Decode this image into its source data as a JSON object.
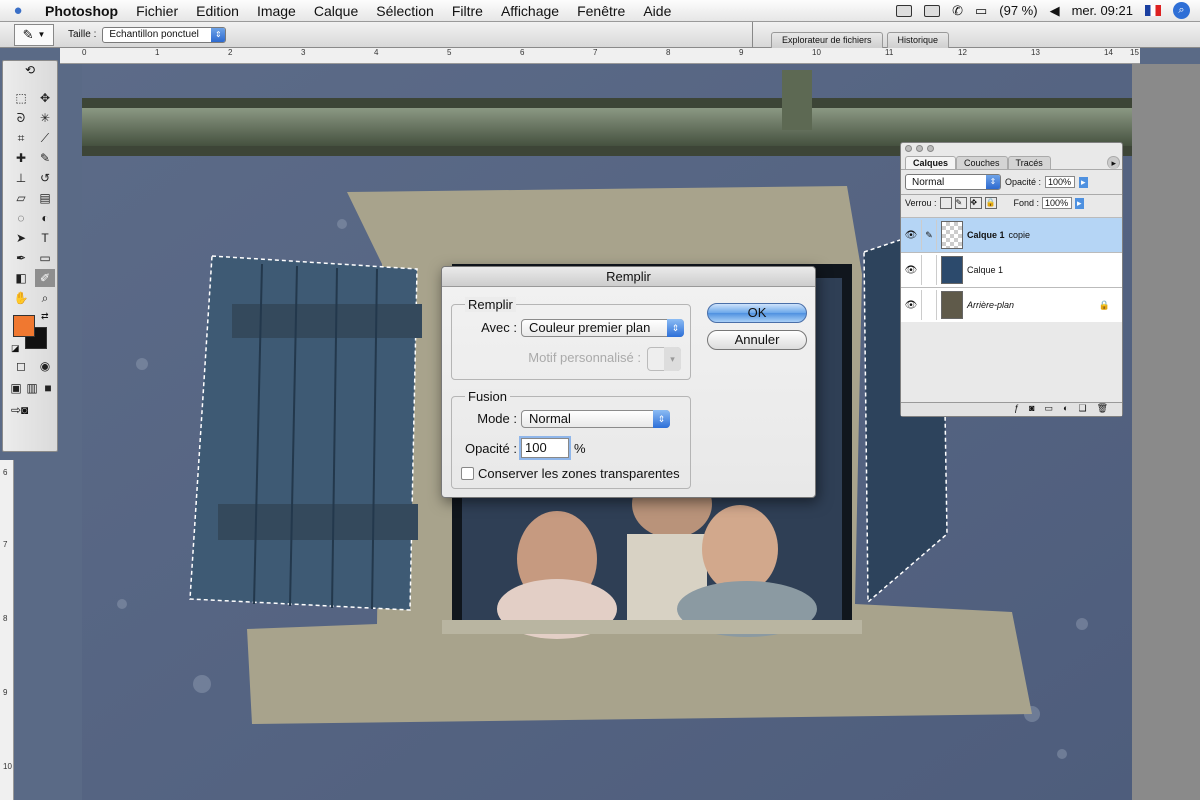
{
  "menubar": {
    "app": "Photoshop",
    "items": [
      "Fichier",
      "Edition",
      "Image",
      "Calque",
      "Sélection",
      "Filtre",
      "Affichage",
      "Fenêtre",
      "Aide"
    ],
    "battery": "(97 %)",
    "clock": "mer. 09:21"
  },
  "options": {
    "size_label": "Taille :",
    "size_value": "Echantillon ponctuel",
    "palette_tabs": [
      "Explorateur de fichiers",
      "Historique"
    ]
  },
  "ruler": {
    "top": [
      "0",
      "1",
      "2",
      "3",
      "4",
      "5",
      "6",
      "7",
      "8",
      "9",
      "10",
      "11",
      "12",
      "13",
      "14",
      "15"
    ],
    "left": [
      "6",
      "7",
      "8",
      "9",
      "10"
    ]
  },
  "layers_panel": {
    "tabs": [
      "Calques",
      "Couches",
      "Tracés"
    ],
    "blend_mode": "Normal",
    "opacity_label": "Opacité :",
    "opacity": "100%",
    "lock_label": "Verrou :",
    "fill_label": "Fond :",
    "fill": "100%",
    "layers": [
      {
        "name": "Calque 1",
        "suffix": "copie",
        "active": true
      },
      {
        "name": "Calque 1",
        "suffix": "",
        "active": false
      },
      {
        "name": "Arrière-plan",
        "suffix": "",
        "active": false
      }
    ]
  },
  "dialog": {
    "title": "Remplir",
    "group_fill": "Remplir",
    "use_label": "Avec :",
    "use_value": "Couleur premier plan",
    "pattern_label": "Motif personnalisé :",
    "group_blend": "Fusion",
    "mode_label": "Mode :",
    "mode_value": "Normal",
    "opacity_label": "Opacité :",
    "opacity_value": "100",
    "percent": "%",
    "preserve_label": "Conserver les zones transparentes",
    "preserve_checked": false,
    "ok": "OK",
    "cancel": "Annuler"
  },
  "colors": {
    "foreground": "#f07830",
    "background": "#111111",
    "accent": "#4f91e0"
  }
}
